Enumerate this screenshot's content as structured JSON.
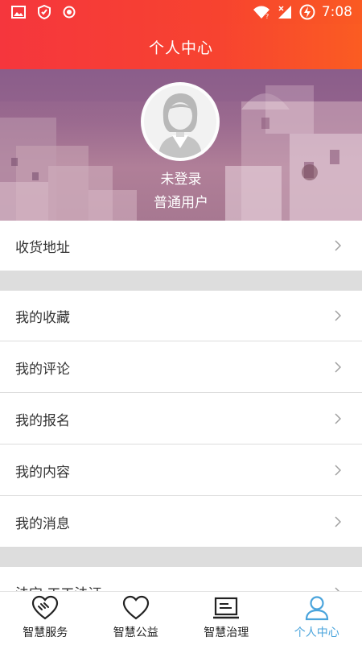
{
  "status_bar": {
    "time": "7:08",
    "left_icons": [
      "image-icon",
      "vpn-shield-icon",
      "record-icon"
    ],
    "right_icons": [
      "wifi-icon",
      "signal-icon",
      "battery-charging-icon"
    ]
  },
  "header": {
    "title": "个人中心"
  },
  "profile": {
    "login_status": "未登录",
    "user_type": "普通用户",
    "avatar_icon": "default-avatar-icon"
  },
  "menu": {
    "address": "收货地址",
    "favorites": "我的收藏",
    "comments": "我的评论",
    "registrations": "我的报名",
    "content": "我的内容",
    "messages": "我的消息",
    "partial_item": "法宝·工工法证"
  },
  "tabs": [
    {
      "label": "智慧服务",
      "icon": "heart-hands-icon",
      "active": false
    },
    {
      "label": "智慧公益",
      "icon": "heart-icon",
      "active": false
    },
    {
      "label": "智慧治理",
      "icon": "laptop-icon",
      "active": false
    },
    {
      "label": "个人中心",
      "icon": "person-icon",
      "active": true
    }
  ],
  "colors": {
    "header_start": "#f5363d",
    "header_end": "#fb5c22",
    "active_tab": "#4aa4dc",
    "separator": "#dddddd"
  }
}
